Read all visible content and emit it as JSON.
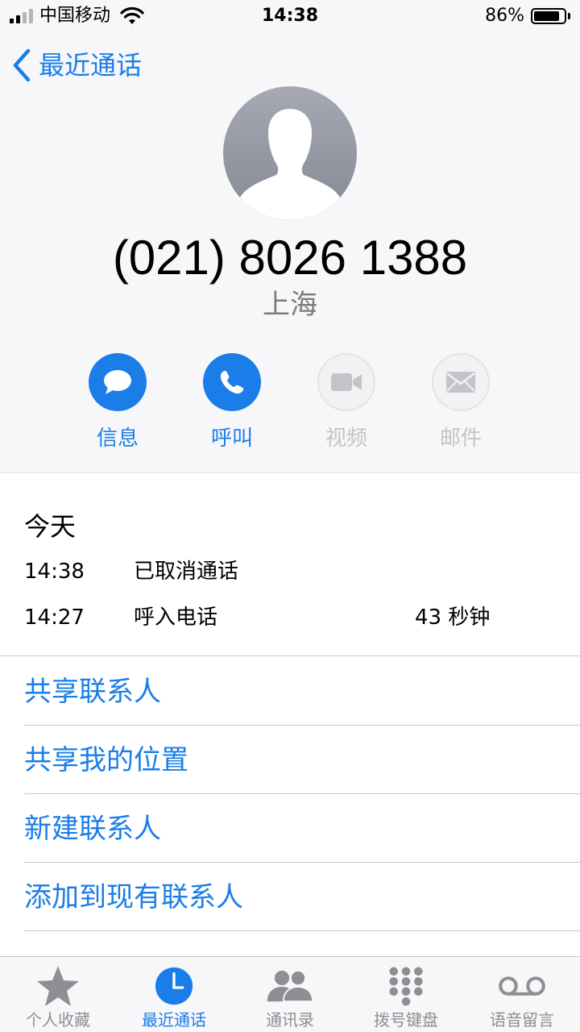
{
  "status_bar": {
    "carrier": "中国移动",
    "time": "14:38",
    "battery_percent": "86%",
    "battery_level": 0.86,
    "signal_bars_filled": 2,
    "signal_bars_total": 4
  },
  "nav": {
    "back_label": "最近通话"
  },
  "contact": {
    "phone_number": "(021) 8026 1388",
    "location": "上海"
  },
  "actions": [
    {
      "label": "信息",
      "icon": "message-bubble-icon",
      "enabled": true
    },
    {
      "label": "呼叫",
      "icon": "phone-icon",
      "enabled": true
    },
    {
      "label": "视频",
      "icon": "video-camera-icon",
      "enabled": false
    },
    {
      "label": "邮件",
      "icon": "envelope-icon",
      "enabled": false
    }
  ],
  "call_log": {
    "day": "今天",
    "entries": [
      {
        "time": "14:38",
        "type": "已取消通话",
        "duration": ""
      },
      {
        "time": "14:27",
        "type": "呼入电话",
        "duration": "43 秒钟"
      }
    ]
  },
  "options": [
    {
      "label": "共享联系人"
    },
    {
      "label": "共享我的位置"
    },
    {
      "label": "新建联系人"
    },
    {
      "label": "添加到现有联系人"
    }
  ],
  "tab_bar": {
    "tabs": [
      {
        "label": "个人收藏",
        "icon": "star-icon",
        "selected": false
      },
      {
        "label": "最近通话",
        "icon": "clock-icon",
        "selected": true
      },
      {
        "label": "通讯录",
        "icon": "contacts-icon",
        "selected": false
      },
      {
        "label": "拨号键盘",
        "icon": "keypad-icon",
        "selected": false
      },
      {
        "label": "语音留言",
        "icon": "voicemail-icon",
        "selected": false
      }
    ]
  },
  "colors": {
    "accent": "#1a7de8",
    "inactive_text": "#c4c4c8",
    "tab_inactive": "#8e8e93"
  }
}
